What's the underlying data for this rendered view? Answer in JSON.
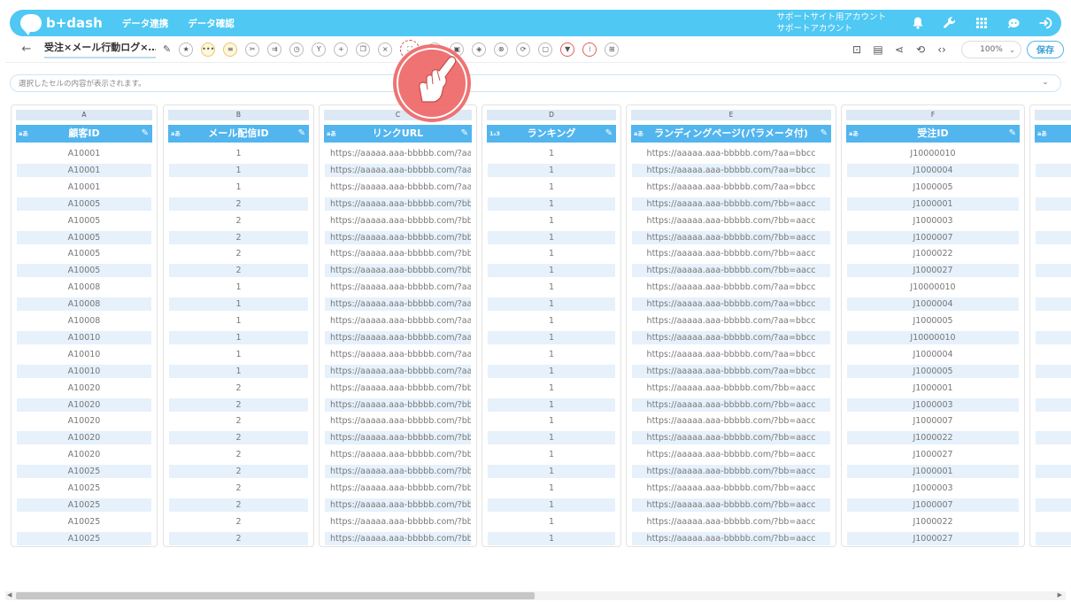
{
  "app": {
    "logo_text": "b+dash",
    "nav": [
      "データ連携",
      "データ確認"
    ],
    "account_line1": "サポートサイト用アカウント",
    "account_line2": "サポートアカウント"
  },
  "toolbar": {
    "title": "受注×メール行動ログ×…",
    "zoom": "100%",
    "save_label": "保存"
  },
  "cellbar": {
    "placeholder": "選択したセルの内容が表示されます。"
  },
  "columns": [
    {
      "letter": "A",
      "type": "a",
      "title": "顧客ID"
    },
    {
      "letter": "B",
      "type": "a",
      "title": "メール配信ID"
    },
    {
      "letter": "C",
      "type": "a",
      "title": "リンクURL"
    },
    {
      "letter": "D",
      "type": "123",
      "title": "ランキング"
    },
    {
      "letter": "E",
      "type": "a",
      "title": "ランディングページ(パラメータ付)"
    },
    {
      "letter": "F",
      "type": "a",
      "title": "受注ID"
    },
    {
      "letter": "",
      "type": "a",
      "title": ""
    }
  ],
  "rows": [
    [
      "A10001",
      "1",
      "https://aaaaa.aaa-bbbbb.com/?aa=bbcc",
      "1",
      "https://aaaaa.aaa-bbbbb.com/?aa=bbcc",
      "J10000010"
    ],
    [
      "A10001",
      "1",
      "https://aaaaa.aaa-bbbbb.com/?aa=bbcc",
      "1",
      "https://aaaaa.aaa-bbbbb.com/?aa=bbcc",
      "J1000004"
    ],
    [
      "A10001",
      "1",
      "https://aaaaa.aaa-bbbbb.com/?aa=bbcc",
      "1",
      "https://aaaaa.aaa-bbbbb.com/?aa=bbcc",
      "J1000005"
    ],
    [
      "A10005",
      "2",
      "https://aaaaa.aaa-bbbbb.com/?bb=aacc",
      "1",
      "https://aaaaa.aaa-bbbbb.com/?bb=aacc",
      "J1000001"
    ],
    [
      "A10005",
      "2",
      "https://aaaaa.aaa-bbbbb.com/?bb=aacc",
      "1",
      "https://aaaaa.aaa-bbbbb.com/?bb=aacc",
      "J1000003"
    ],
    [
      "A10005",
      "2",
      "https://aaaaa.aaa-bbbbb.com/?bb=aacc",
      "1",
      "https://aaaaa.aaa-bbbbb.com/?bb=aacc",
      "J1000007"
    ],
    [
      "A10005",
      "2",
      "https://aaaaa.aaa-bbbbb.com/?bb=aacc",
      "1",
      "https://aaaaa.aaa-bbbbb.com/?bb=aacc",
      "J1000022"
    ],
    [
      "A10005",
      "2",
      "https://aaaaa.aaa-bbbbb.com/?bb=aacc",
      "1",
      "https://aaaaa.aaa-bbbbb.com/?bb=aacc",
      "J1000027"
    ],
    [
      "A10008",
      "1",
      "https://aaaaa.aaa-bbbbb.com/?aa=bbcc",
      "1",
      "https://aaaaa.aaa-bbbbb.com/?aa=bbcc",
      "J10000010"
    ],
    [
      "A10008",
      "1",
      "https://aaaaa.aaa-bbbbb.com/?aa=bbcc",
      "1",
      "https://aaaaa.aaa-bbbbb.com/?aa=bbcc",
      "J1000004"
    ],
    [
      "A10008",
      "1",
      "https://aaaaa.aaa-bbbbb.com/?aa=bbcc",
      "1",
      "https://aaaaa.aaa-bbbbb.com/?aa=bbcc",
      "J1000005"
    ],
    [
      "A10010",
      "1",
      "https://aaaaa.aaa-bbbbb.com/?aa=bbcc",
      "1",
      "https://aaaaa.aaa-bbbbb.com/?aa=bbcc",
      "J10000010"
    ],
    [
      "A10010",
      "1",
      "https://aaaaa.aaa-bbbbb.com/?aa=bbcc",
      "1",
      "https://aaaaa.aaa-bbbbb.com/?aa=bbcc",
      "J1000004"
    ],
    [
      "A10010",
      "1",
      "https://aaaaa.aaa-bbbbb.com/?aa=bbcc",
      "1",
      "https://aaaaa.aaa-bbbbb.com/?aa=bbcc",
      "J1000005"
    ],
    [
      "A10020",
      "2",
      "https://aaaaa.aaa-bbbbb.com/?bb=aacc",
      "1",
      "https://aaaaa.aaa-bbbbb.com/?bb=aacc",
      "J1000001"
    ],
    [
      "A10020",
      "2",
      "https://aaaaa.aaa-bbbbb.com/?bb=aacc",
      "1",
      "https://aaaaa.aaa-bbbbb.com/?bb=aacc",
      "J1000003"
    ],
    [
      "A10020",
      "2",
      "https://aaaaa.aaa-bbbbb.com/?bb=aacc",
      "1",
      "https://aaaaa.aaa-bbbbb.com/?bb=aacc",
      "J1000007"
    ],
    [
      "A10020",
      "2",
      "https://aaaaa.aaa-bbbbb.com/?bb=aacc",
      "1",
      "https://aaaaa.aaa-bbbbb.com/?bb=aacc",
      "J1000022"
    ],
    [
      "A10020",
      "2",
      "https://aaaaa.aaa-bbbbb.com/?bb=aacc",
      "1",
      "https://aaaaa.aaa-bbbbb.com/?bb=aacc",
      "J1000027"
    ],
    [
      "A10025",
      "2",
      "https://aaaaa.aaa-bbbbb.com/?bb=aacc",
      "1",
      "https://aaaaa.aaa-bbbbb.com/?bb=aacc",
      "J1000001"
    ],
    [
      "A10025",
      "2",
      "https://aaaaa.aaa-bbbbb.com/?bb=aacc",
      "1",
      "https://aaaaa.aaa-bbbbb.com/?bb=aacc",
      "J1000003"
    ],
    [
      "A10025",
      "2",
      "https://aaaaa.aaa-bbbbb.com/?bb=aacc",
      "1",
      "https://aaaaa.aaa-bbbbb.com/?bb=aacc",
      "J1000007"
    ],
    [
      "A10025",
      "2",
      "https://aaaaa.aaa-bbbbb.com/?bb=aacc",
      "1",
      "https://aaaaa.aaa-bbbbb.com/?bb=aacc",
      "J1000022"
    ],
    [
      "A10025",
      "2",
      "https://aaaaa.aaa-bbbbb.com/?bb=aacc",
      "1",
      "https://aaaaa.aaa-bbbbb.com/?bb=aacc",
      "J1000027"
    ]
  ],
  "colors": {
    "brand": "#4fc8f3",
    "header_blue": "#52b5ee",
    "alt_row": "#e6f1fb",
    "highlight_red": "#e04545"
  }
}
